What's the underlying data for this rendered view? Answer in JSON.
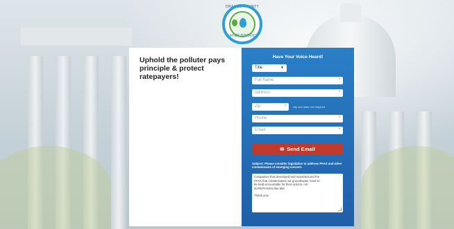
{
  "logo": {
    "ring_top": "ORANGE COUNTY",
    "ring_bottom": "WATER DISTRICT",
    "icon": "water-district-seal"
  },
  "headline": "Uphold the polluter pays principle & protect ratepayers!",
  "form": {
    "title": "Have Your Voice Heard!",
    "title_select": "Title",
    "fields": {
      "full_name": "Full Name",
      "address": "Address",
      "zip": "Zip",
      "zip_hint": "city and state not required",
      "phone": "Phone",
      "email": "Email"
    },
    "required_marker": "*",
    "send_label": "Send Email",
    "send_icon": "envelope-icon",
    "subject": "Subject: Please consider legislation to address PFAS and other contaminants of emerging concern",
    "message_lines": [
      "Companies that developed and manufactured the",
      "PFAS that contaminated our groundwater need to",
      "be held accountable for their actions, not",
      "RATEPAYERS like ME!"
    ],
    "message_signoff": "Thank you!"
  },
  "colors": {
    "form_blue": "#2a7fc6",
    "button_red": "#c0392b",
    "logo_blue": "#2e9fd3",
    "logo_green": "#5aa945"
  }
}
